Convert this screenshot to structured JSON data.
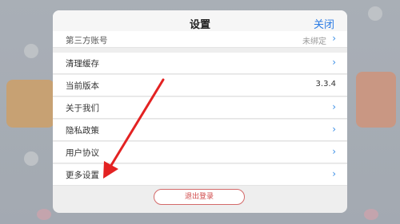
{
  "modal": {
    "title": "设置",
    "close_label": "关闭"
  },
  "settings": {
    "third_party_label": "第三方账号",
    "third_party_value": "未绑定",
    "clear_cache_label": "清理缓存",
    "version_label": "当前版本",
    "version_value": "3.3.4",
    "about_label": "关于我们",
    "privacy_label": "隐私政策",
    "user_agreement_label": "用户协议",
    "more_settings_label": "更多设置"
  },
  "logout_label": "退出登录",
  "icons": {
    "chevron": "›"
  },
  "colors": {
    "accent_blue": "#2a7be4",
    "logout_red": "#d04a4a",
    "annotation_arrow": "#e32222"
  }
}
